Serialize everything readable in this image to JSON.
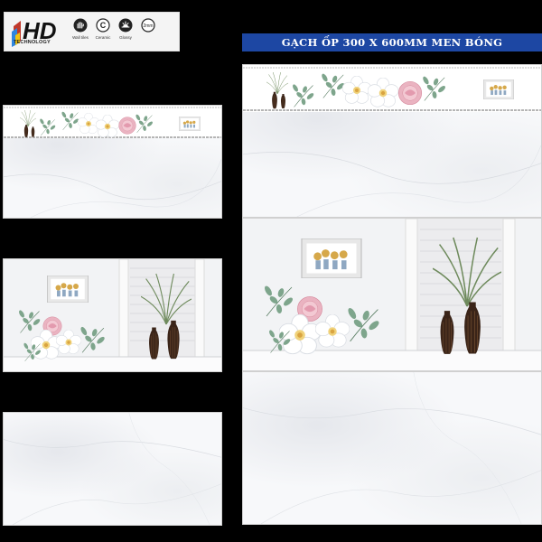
{
  "logo": {
    "brand": "HD",
    "subtitle": "TECHNOLOGY",
    "features": [
      {
        "icon": "wall-hand-icon",
        "label": "Wall tiles"
      },
      {
        "icon": "ceramic-c-icon",
        "label": "Ceramic"
      },
      {
        "icon": "glossy-icon",
        "label": "Glossy"
      },
      {
        "icon": "thickness-icon",
        "label": "",
        "badge": "2mm"
      }
    ]
  },
  "title": "GẠCH ỐP 300 X 600MM MEN BÓNG",
  "colors": {
    "background": "#000000",
    "title_bar": "#1d47a3",
    "tile": "#f7f8fa",
    "rose": "#e8a9b8",
    "vase": "#3a2418",
    "leaf": "#6f9a7e"
  }
}
